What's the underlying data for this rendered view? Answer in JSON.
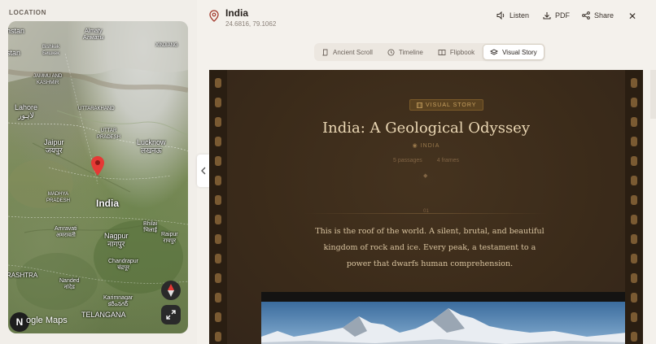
{
  "location_panel": {
    "label": "LOCATION",
    "map": {
      "labels": [
        {
          "text": "Almaty\nАлматы"
        },
        {
          "text": "XINJIANG"
        },
        {
          "text": "Bishkek\nБишкек"
        },
        {
          "text": "JAMMU AND\nKASHMIR"
        },
        {
          "text": "Lahore\nلاہور"
        },
        {
          "text": "UTTARAKHAND"
        },
        {
          "text": "UTTAR\nPRADESH"
        },
        {
          "text": "Jaipur\nजयपुर"
        },
        {
          "text": "Lucknow\nलखनऊ"
        },
        {
          "text": "MADHYA\nPRADESH"
        },
        {
          "text": "India"
        },
        {
          "text": "Bhilai\nभिलाई"
        },
        {
          "text": "Amravati\nअमरावती"
        },
        {
          "text": "Nagpur\nनागपुर"
        },
        {
          "text": "Raipur\nरायपुर"
        },
        {
          "text": "Chandrapur\nचंद्रपूर"
        },
        {
          "text": "RASHTRA"
        },
        {
          "text": "Nanded\nनांदेड"
        },
        {
          "text": "Karimnagar\nకరీంనగర్"
        },
        {
          "text": "TELANGANA"
        },
        {
          "text": "hstan"
        },
        {
          "text": "stan"
        }
      ],
      "attribution": "ogle Maps",
      "compass_label": "N"
    }
  },
  "header": {
    "title": "India",
    "coords": "24.6816, 79.1062",
    "listen_label": "Listen",
    "pdf_label": "PDF",
    "share_label": "Share",
    "close_glyph": "✕"
  },
  "tabs": [
    {
      "label": "Ancient Scroll",
      "active": false
    },
    {
      "label": "Timeline",
      "active": false
    },
    {
      "label": "Flipbook",
      "active": false
    },
    {
      "label": "Visual Story",
      "active": true
    }
  ],
  "story": {
    "badge": "VISUAL STORY",
    "title": "India: A Geological Odyssey",
    "location": "INDIA",
    "meta_chapters": "5 passages",
    "meta_images": "4 frames",
    "chapter_number": "01",
    "paragraph": "This is the roof of the world. A silent, brutal, and beautiful kingdom of rock and ice. Every peak, a testament to a power that dwarfs human comprehension."
  },
  "colors": {
    "accent_pin": "#e53935",
    "film_bg": "#3a2b1b",
    "title_text": "#ead7b4"
  }
}
